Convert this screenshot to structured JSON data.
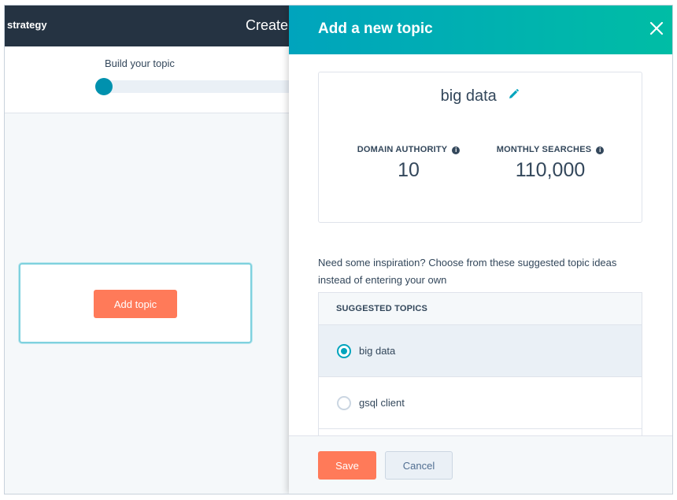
{
  "background_page": {
    "app_name": "strategy",
    "page_title": "Create",
    "step_label": "Build your topic",
    "add_topic_label": "Add topic"
  },
  "panel": {
    "title": "Add a new topic",
    "close_icon": "close-icon",
    "topic_name": "big data",
    "edit_icon": "pencil-icon",
    "metrics": {
      "domain_authority_label": "DOMAIN AUTHORITY",
      "domain_authority_value": "10",
      "monthly_searches_label": "MONTHLY SEARCHES",
      "monthly_searches_value": "110,000",
      "info_icon_glyph": "i"
    },
    "inspiration_text": "Need some inspiration? Choose from these suggested topic ideas instead of entering your own",
    "suggested_header": "SUGGESTED TOPICS",
    "suggested_topics": [
      {
        "label": "big data",
        "selected": true
      },
      {
        "label": "gsql client",
        "selected": false
      }
    ],
    "footer": {
      "save_label": "Save",
      "cancel_label": "Cancel"
    }
  },
  "colors": {
    "accent": "#00a4bd",
    "primary_button": "#ff7a59",
    "topbar": "#253342"
  }
}
